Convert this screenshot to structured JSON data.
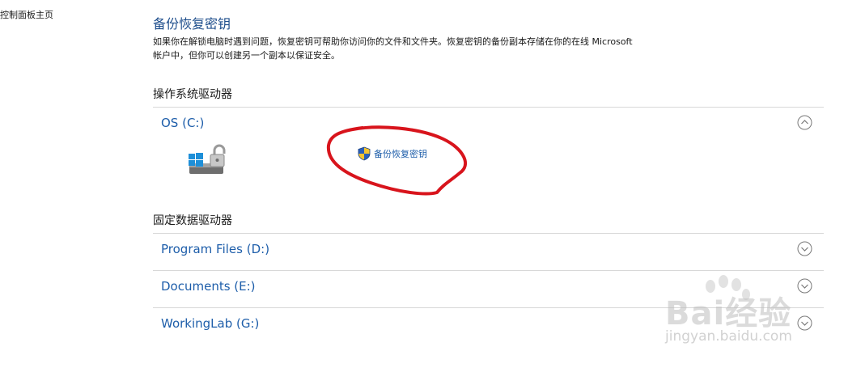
{
  "left_nav": {
    "home_link": "控制面板主页"
  },
  "header": {
    "title": "备份恢复密钥",
    "description": "如果你在解锁电脑时遇到问题，恢复密钥可帮助你访问你的文件和文件夹。恢复密钥的备份副本存储在你的在线 Microsoft 帐户中，但你可以创建另一个副本以保证安全。"
  },
  "os_section": {
    "heading": "操作系统驱动器",
    "drive": {
      "name": "OS (C:)",
      "state": "expanded",
      "action_label": "备份恢复密钥"
    }
  },
  "fixed_section": {
    "heading": "固定数据驱动器",
    "drives": [
      {
        "name": "Program Files (D:)",
        "state": "collapsed"
      },
      {
        "name": "Documents (E:)",
        "state": "collapsed"
      },
      {
        "name": "WorkingLab (G:)",
        "state": "collapsed"
      }
    ]
  },
  "watermark": {
    "brand": "Bai经验",
    "url": "jingyan.baidu.com"
  },
  "colors": {
    "link_blue": "#1e5eaa",
    "annotation_red": "#d8141c",
    "divider": "#d8d8d8"
  },
  "icons": {
    "chevron_up": "chevron-up-icon",
    "chevron_down": "chevron-down-icon",
    "shield": "uac-shield-icon",
    "drive": "bitlocker-drive-icon"
  }
}
